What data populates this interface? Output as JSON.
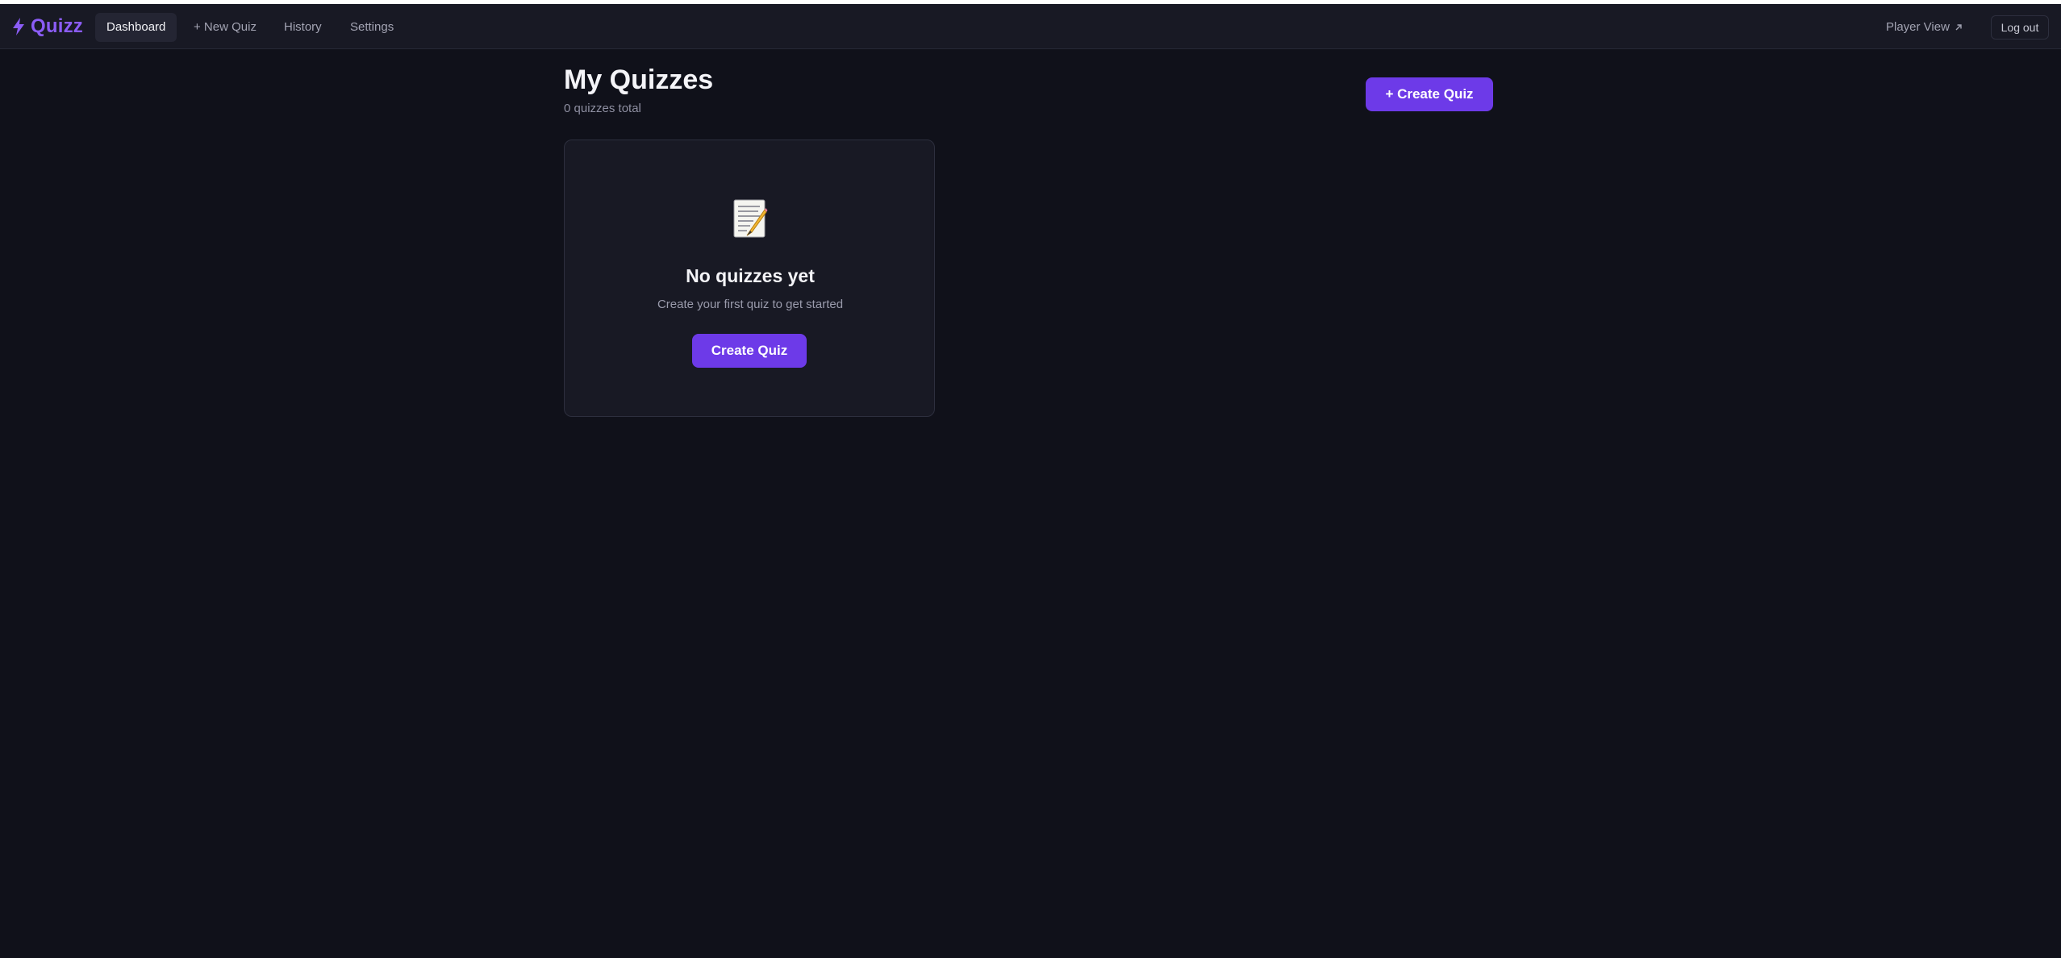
{
  "app": {
    "name": "Quizz",
    "logo_icon": "lightning-bolt-icon",
    "accent": "#8b5cf6",
    "button_color": "#6d3ae8"
  },
  "nav": {
    "items": [
      {
        "label": "Dashboard",
        "active": true
      },
      {
        "label": "+ New Quiz",
        "active": false
      },
      {
        "label": "History",
        "active": false
      },
      {
        "label": "Settings",
        "active": false
      }
    ],
    "player_view": "Player View",
    "player_view_icon": "external-arrow-icon",
    "logout": "Log out"
  },
  "main": {
    "title": "My Quizzes",
    "subtitle": "0 quizzes total",
    "create_button": "+ Create Quiz"
  },
  "empty_state": {
    "icon": "memo-icon",
    "title": "No quizzes yet",
    "description": "Create your first quiz to get started",
    "button": "Create Quiz"
  }
}
